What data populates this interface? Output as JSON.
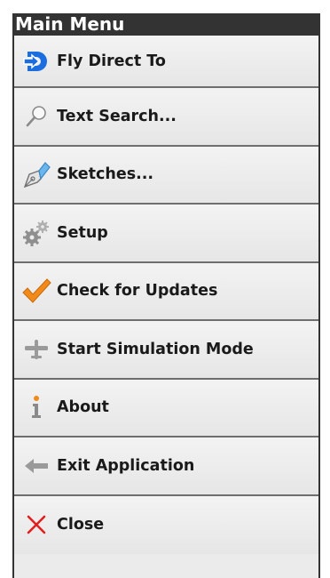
{
  "menu": {
    "title": "Main Menu",
    "items": [
      {
        "label": "Fly Direct To",
        "icon": "fly-direct-to-icon"
      },
      {
        "label": "Text Search...",
        "icon": "magnifier-icon"
      },
      {
        "label": "Sketches...",
        "icon": "pen-icon"
      },
      {
        "label": "Setup",
        "icon": "gears-icon"
      },
      {
        "label": "Check for Updates",
        "icon": "checkmark-icon"
      },
      {
        "label": "Start Simulation Mode",
        "icon": "airplane-icon"
      },
      {
        "label": "About",
        "icon": "info-icon"
      },
      {
        "label": "Exit Application",
        "icon": "arrow-left-icon"
      },
      {
        "label": "Close",
        "icon": "close-x-icon"
      }
    ]
  },
  "colors": {
    "header_bg": "#333333",
    "item_bg": "#ebebeb",
    "fly_direct_blue": "#1a6ee0",
    "check_orange": "#f28a1a",
    "info_orange": "#f28a1a",
    "close_red": "#e02020"
  }
}
